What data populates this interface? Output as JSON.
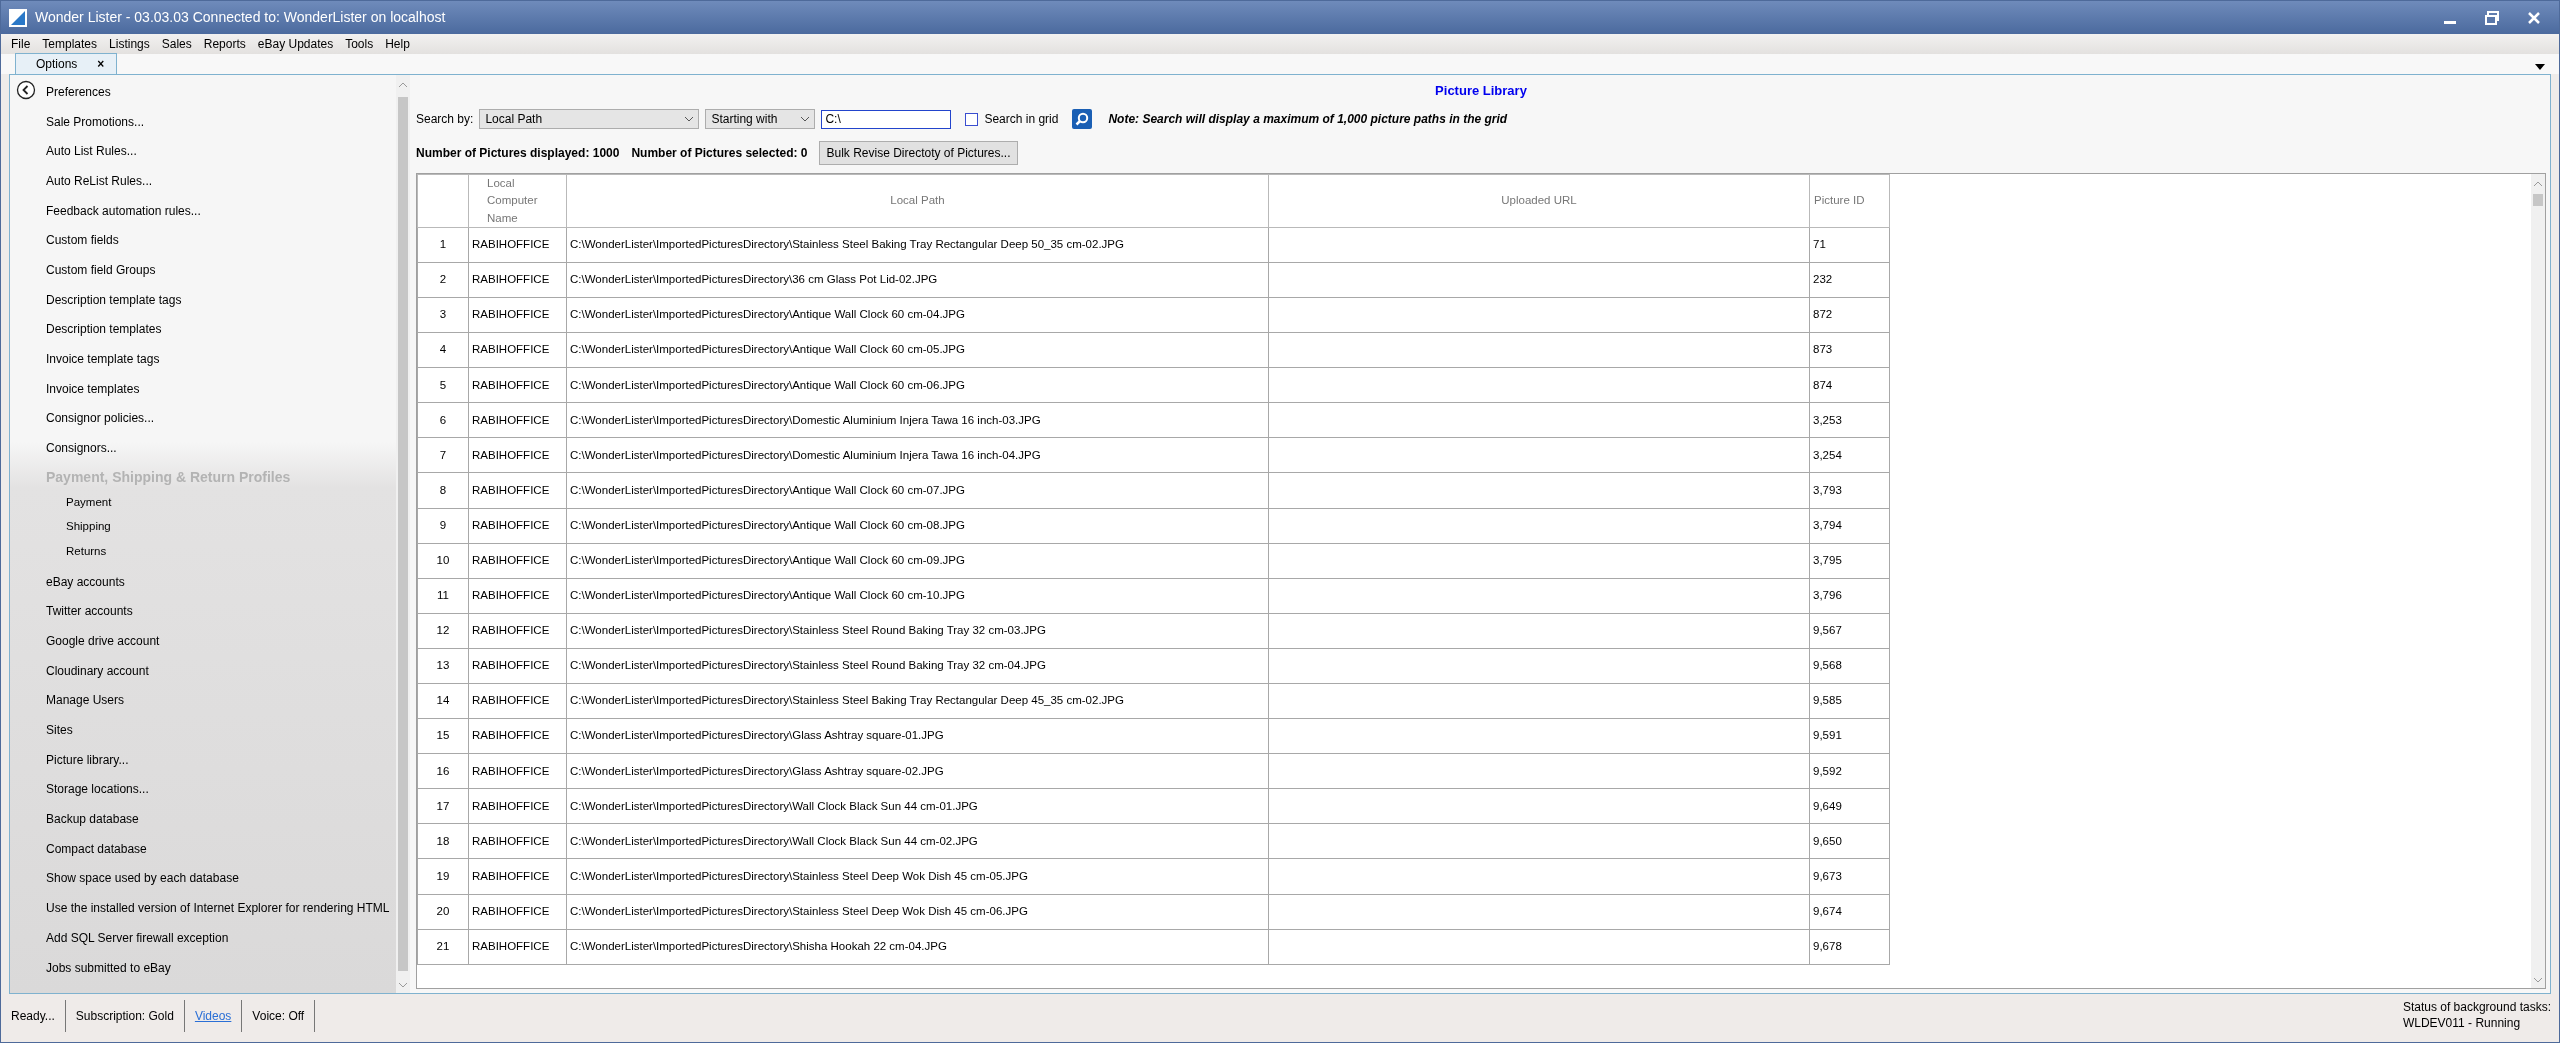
{
  "window": {
    "title": "Wonder Lister - 03.03.03 Connected to: WonderLister on localhost"
  },
  "menu": [
    "File",
    "Templates",
    "Listings",
    "Sales",
    "Reports",
    "eBay Updates",
    "Tools",
    "Help"
  ],
  "tabs": [
    {
      "label": "Options",
      "selected": true,
      "close": "×"
    }
  ],
  "sidebar": {
    "items": [
      {
        "kind": "item",
        "label": "Preferences"
      },
      {
        "kind": "item",
        "label": "Sale Promotions..."
      },
      {
        "kind": "item",
        "label": "Auto List Rules..."
      },
      {
        "kind": "item",
        "label": "Auto ReList Rules..."
      },
      {
        "kind": "item",
        "label": "Feedback automation rules..."
      },
      {
        "kind": "item",
        "label": "Custom fields"
      },
      {
        "kind": "item",
        "label": "Custom field Groups"
      },
      {
        "kind": "item",
        "label": "Description template tags"
      },
      {
        "kind": "item",
        "label": "Description templates"
      },
      {
        "kind": "item",
        "label": "Invoice template tags"
      },
      {
        "kind": "item",
        "label": "Invoice templates"
      },
      {
        "kind": "item",
        "label": "Consignor policies..."
      },
      {
        "kind": "item",
        "label": "Consignors..."
      },
      {
        "kind": "group",
        "label": "Payment, Shipping & Return Profiles",
        "children": [
          {
            "label": "Payment"
          },
          {
            "label": "Shipping"
          },
          {
            "label": "Returns"
          }
        ]
      },
      {
        "kind": "item",
        "label": "eBay accounts"
      },
      {
        "kind": "item",
        "label": "Twitter accounts"
      },
      {
        "kind": "item",
        "label": "Google drive account"
      },
      {
        "kind": "item",
        "label": "Cloudinary account"
      },
      {
        "kind": "item",
        "label": "Manage Users"
      },
      {
        "kind": "item",
        "label": "Sites"
      },
      {
        "kind": "item",
        "label": "Picture library..."
      },
      {
        "kind": "item",
        "label": "Storage locations..."
      },
      {
        "kind": "item",
        "label": "Backup database"
      },
      {
        "kind": "item",
        "label": "Compact database"
      },
      {
        "kind": "item",
        "label": "Show space used by each database"
      },
      {
        "kind": "item",
        "label": "Use the installed version of Internet Explorer for rendering HTML"
      },
      {
        "kind": "item",
        "label": "Add SQL Server firewall exception"
      },
      {
        "kind": "item",
        "label": "Jobs submitted to eBay"
      }
    ]
  },
  "panel": {
    "title": "Picture Library",
    "search": {
      "label": "Search by:",
      "field": "Local Path",
      "mode": "Starting with",
      "value": "C:\\",
      "grid_label": "Search in grid",
      "grid_checked": false,
      "note": "Note: Search will display a maximum of 1,000 picture paths in the grid"
    },
    "counts": {
      "displayed": "Number of Pictures displayed: 1000",
      "selected": "Number of Pictures selected: 0",
      "button": "Bulk Revise Directoty of Pictures..."
    },
    "table": {
      "columns": [
        "Local Computer Name",
        "Local Path",
        "Uploaded URL",
        "Picture ID"
      ],
      "rows": [
        {
          "n": "1",
          "computer": "RABIHOFFICE",
          "path": "C:\\WonderLister\\ImportedPicturesDirectory\\Stainless Steel Baking Tray Rectangular Deep 50_35 cm-02.JPG",
          "id": "71"
        },
        {
          "n": "2",
          "computer": "RABIHOFFICE",
          "path": "C:\\WonderLister\\ImportedPicturesDirectory\\36 cm Glass Pot Lid-02.JPG",
          "id": "232"
        },
        {
          "n": "3",
          "computer": "RABIHOFFICE",
          "path": "C:\\WonderLister\\ImportedPicturesDirectory\\Antique Wall Clock 60 cm-04.JPG",
          "id": "872"
        },
        {
          "n": "4",
          "computer": "RABIHOFFICE",
          "path": "C:\\WonderLister\\ImportedPicturesDirectory\\Antique Wall Clock 60 cm-05.JPG",
          "id": "873"
        },
        {
          "n": "5",
          "computer": "RABIHOFFICE",
          "path": "C:\\WonderLister\\ImportedPicturesDirectory\\Antique Wall Clock 60 cm-06.JPG",
          "id": "874"
        },
        {
          "n": "6",
          "computer": "RABIHOFFICE",
          "path": "C:\\WonderLister\\ImportedPicturesDirectory\\Domestic Aluminium Injera Tawa 16 inch-03.JPG",
          "id": "3,253"
        },
        {
          "n": "7",
          "computer": "RABIHOFFICE",
          "path": "C:\\WonderLister\\ImportedPicturesDirectory\\Domestic Aluminium Injera Tawa 16 inch-04.JPG",
          "id": "3,254"
        },
        {
          "n": "8",
          "computer": "RABIHOFFICE",
          "path": "C:\\WonderLister\\ImportedPicturesDirectory\\Antique Wall Clock 60 cm-07.JPG",
          "id": "3,793"
        },
        {
          "n": "9",
          "computer": "RABIHOFFICE",
          "path": "C:\\WonderLister\\ImportedPicturesDirectory\\Antique Wall Clock 60 cm-08.JPG",
          "id": "3,794"
        },
        {
          "n": "10",
          "computer": "RABIHOFFICE",
          "path": "C:\\WonderLister\\ImportedPicturesDirectory\\Antique Wall Clock 60 cm-09.JPG",
          "id": "3,795"
        },
        {
          "n": "11",
          "computer": "RABIHOFFICE",
          "path": "C:\\WonderLister\\ImportedPicturesDirectory\\Antique Wall Clock 60 cm-10.JPG",
          "id": "3,796"
        },
        {
          "n": "12",
          "computer": "RABIHOFFICE",
          "path": "C:\\WonderLister\\ImportedPicturesDirectory\\Stainless Steel Round Baking Tray 32 cm-03.JPG",
          "id": "9,567"
        },
        {
          "n": "13",
          "computer": "RABIHOFFICE",
          "path": "C:\\WonderLister\\ImportedPicturesDirectory\\Stainless Steel Round Baking Tray 32 cm-04.JPG",
          "id": "9,568"
        },
        {
          "n": "14",
          "computer": "RABIHOFFICE",
          "path": "C:\\WonderLister\\ImportedPicturesDirectory\\Stainless Steel Baking Tray Rectangular Deep 45_35 cm-02.JPG",
          "id": "9,585"
        },
        {
          "n": "15",
          "computer": "RABIHOFFICE",
          "path": "C:\\WonderLister\\ImportedPicturesDirectory\\Glass Ashtray square-01.JPG",
          "id": "9,591"
        },
        {
          "n": "16",
          "computer": "RABIHOFFICE",
          "path": "C:\\WonderLister\\ImportedPicturesDirectory\\Glass Ashtray square-02.JPG",
          "id": "9,592"
        },
        {
          "n": "17",
          "computer": "RABIHOFFICE",
          "path": "C:\\WonderLister\\ImportedPicturesDirectory\\Wall Clock Black Sun 44 cm-01.JPG",
          "id": "9,649"
        },
        {
          "n": "18",
          "computer": "RABIHOFFICE",
          "path": "C:\\WonderLister\\ImportedPicturesDirectory\\Wall Clock Black Sun 44 cm-02.JPG",
          "id": "9,650"
        },
        {
          "n": "19",
          "computer": "RABIHOFFICE",
          "path": "C:\\WonderLister\\ImportedPicturesDirectory\\Stainless Steel Deep Wok Dish 45 cm-05.JPG",
          "id": "9,673"
        },
        {
          "n": "20",
          "computer": "RABIHOFFICE",
          "path": "C:\\WonderLister\\ImportedPicturesDirectory\\Stainless Steel Deep Wok Dish 45 cm-06.JPG",
          "id": "9,674"
        },
        {
          "n": "21",
          "computer": "RABIHOFFICE",
          "path": "C:\\WonderLister\\ImportedPicturesDirectory\\Shisha Hookah 22 cm-04.JPG",
          "id": "9,678"
        }
      ]
    }
  },
  "status_bar": {
    "segments": [
      {
        "kind": "text",
        "text": "Ready..."
      },
      {
        "kind": "text",
        "text": "Subscription: Gold"
      },
      {
        "kind": "link",
        "text": "Videos"
      },
      {
        "kind": "text",
        "text": "Voice:  Off"
      }
    ],
    "background_label": "Status of background tasks:",
    "background_value": "WLDEV011 - Running"
  }
}
